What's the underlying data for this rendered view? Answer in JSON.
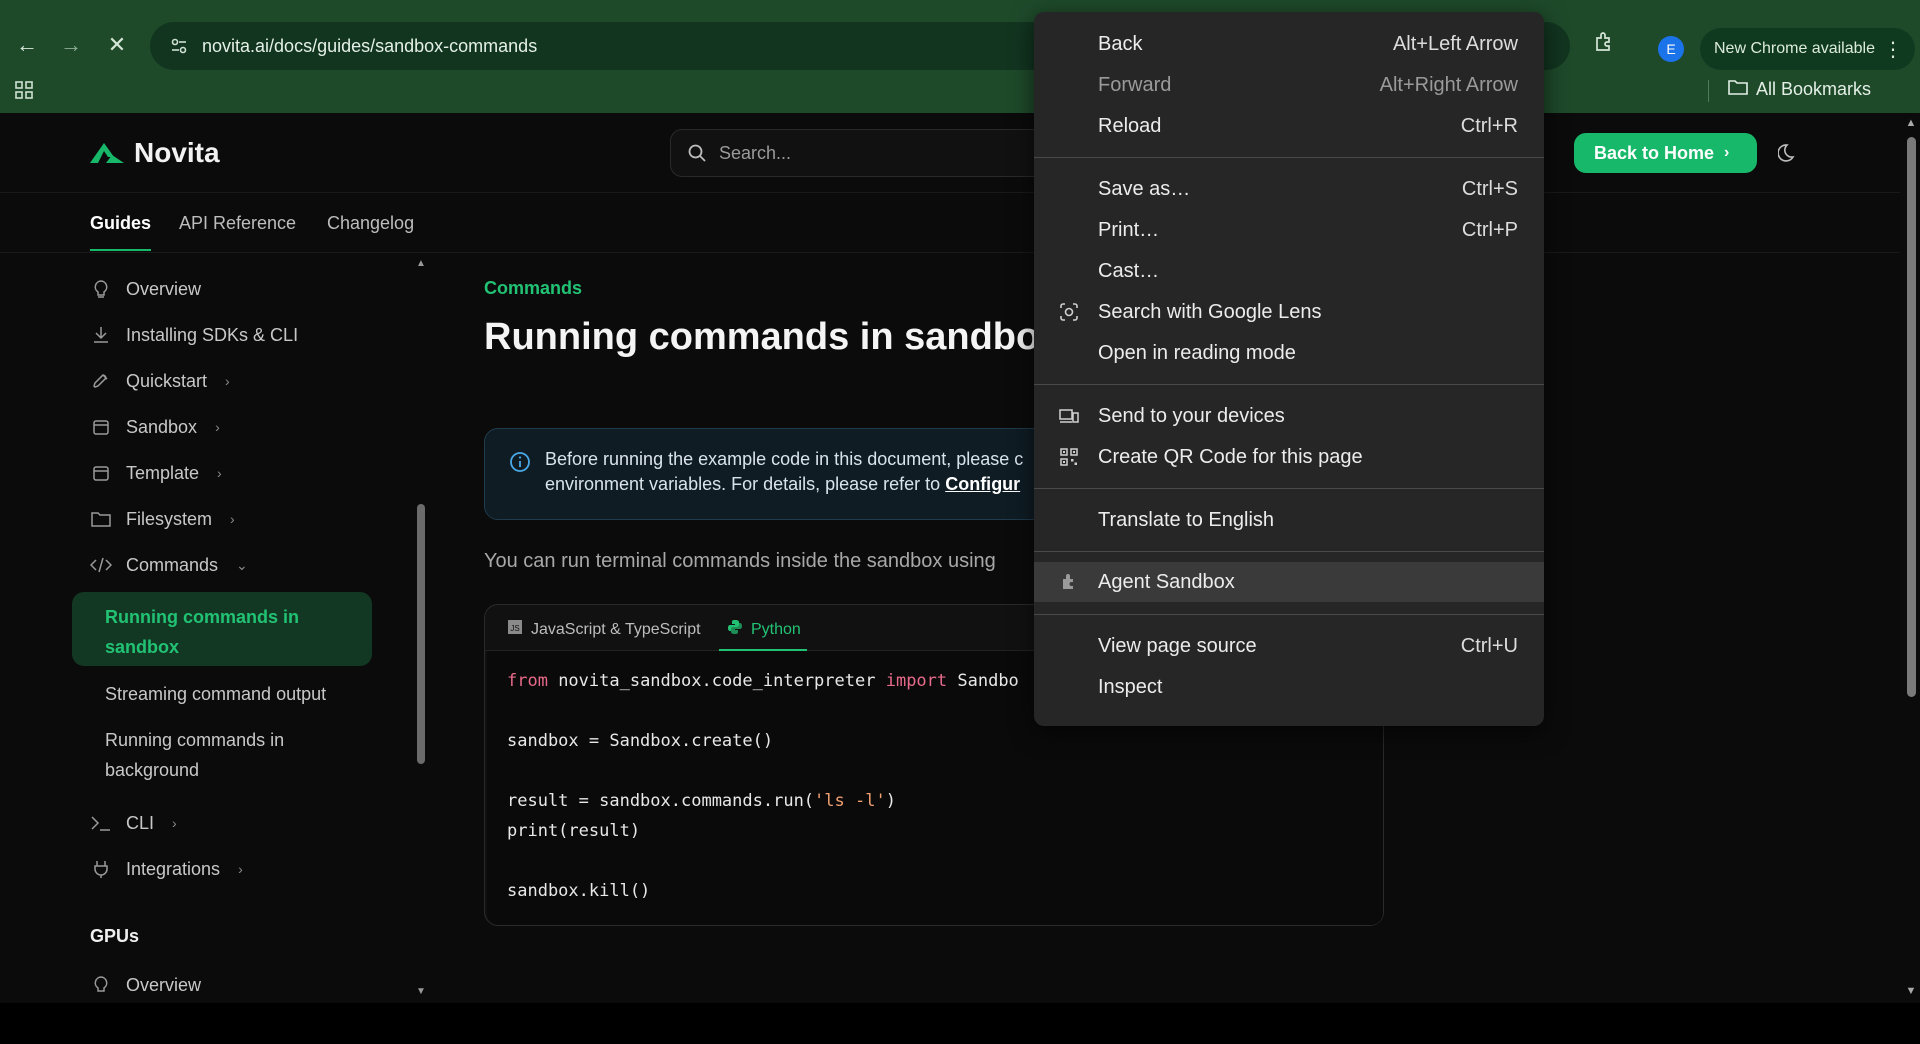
{
  "browser": {
    "url": "novita.ai/docs/guides/sandbox-commands",
    "new_chrome_label": "New Chrome available",
    "avatar_letter": "E",
    "all_bookmarks_label": "All Bookmarks"
  },
  "site": {
    "logo_text": "Novita",
    "search_placeholder": "Search...",
    "back_home_label": "Back to Home",
    "tabs": [
      {
        "label": "Guides",
        "active": true
      },
      {
        "label": "API Reference",
        "active": false
      },
      {
        "label": "Changelog",
        "active": false
      }
    ]
  },
  "sidebar": {
    "items": [
      {
        "label": "Overview",
        "icon": "lightbulb-icon"
      },
      {
        "label": "Installing SDKs & CLI",
        "icon": "download-icon"
      },
      {
        "label": "Quickstart",
        "icon": "rocket-icon",
        "chevron": "›"
      },
      {
        "label": "Sandbox",
        "icon": "box-icon",
        "chevron": "›"
      },
      {
        "label": "Template",
        "icon": "template-icon",
        "chevron": "›"
      },
      {
        "label": "Filesystem",
        "icon": "folder-icon",
        "chevron": "›"
      },
      {
        "label": "Commands",
        "icon": "code-icon",
        "chevron": "⌄"
      }
    ],
    "sub_items": [
      {
        "label": "Running commands in sandbox",
        "active": true
      },
      {
        "label": "Streaming command output"
      },
      {
        "label": "Running commands in background"
      }
    ],
    "items_after": [
      {
        "label": "CLI",
        "icon": "terminal-icon",
        "chevron": "›"
      },
      {
        "label": "Integrations",
        "icon": "plug-icon",
        "chevron": "›"
      }
    ],
    "group_gpus": "GPUs",
    "gpus_overview": "Overview"
  },
  "content": {
    "breadcrumb": "Commands",
    "title": "Running commands in sandbox",
    "callout_text": "Before running the example code in this document, please c",
    "callout_text2": "environment variables. For details, please refer to ",
    "callout_link": "Configur",
    "paragraph": "You can run terminal commands inside the sandbox using",
    "code_tabs": [
      {
        "label": "JavaScript & TypeScript",
        "active": false
      },
      {
        "label": "Python",
        "active": true
      }
    ],
    "code": {
      "l1_kw1": "from",
      "l1_mod": " novita_sandbox.code_interpreter ",
      "l1_kw2": "import",
      "l1_rest": " Sandbo",
      "l2": "sandbox = Sandbox.create()",
      "l3a": "result = sandbox.commands.run(",
      "l3s": "'ls -l'",
      "l3b": ")",
      "l4": "print(result)",
      "l5": "sandbox.kill()"
    }
  },
  "context_menu": {
    "items": [
      {
        "label": "Back",
        "shortcut": "Alt+Left Arrow"
      },
      {
        "label": "Forward",
        "shortcut": "Alt+Right Arrow",
        "disabled": true
      },
      {
        "label": "Reload",
        "shortcut": "Ctrl+R"
      },
      {
        "label": "Save as…",
        "shortcut": "Ctrl+S"
      },
      {
        "label": "Print…",
        "shortcut": "Ctrl+P"
      },
      {
        "label": "Cast…"
      },
      {
        "label": "Search with Google Lens",
        "icon": "google-lens-icon"
      },
      {
        "label": "Open in reading mode"
      },
      {
        "label": "Send to your devices",
        "icon": "devices-icon"
      },
      {
        "label": "Create QR Code for this page",
        "icon": "qr-code-icon"
      },
      {
        "label": "Translate to English"
      },
      {
        "label": "Agent Sandbox",
        "icon": "extension-icon",
        "highlighted": true
      },
      {
        "label": "View page source",
        "shortcut": "Ctrl+U"
      },
      {
        "label": "Inspect"
      }
    ]
  },
  "colors": {
    "accent": "#18b86a",
    "chrome_frame": "#1e4a2a",
    "menu_bg": "#262626"
  }
}
